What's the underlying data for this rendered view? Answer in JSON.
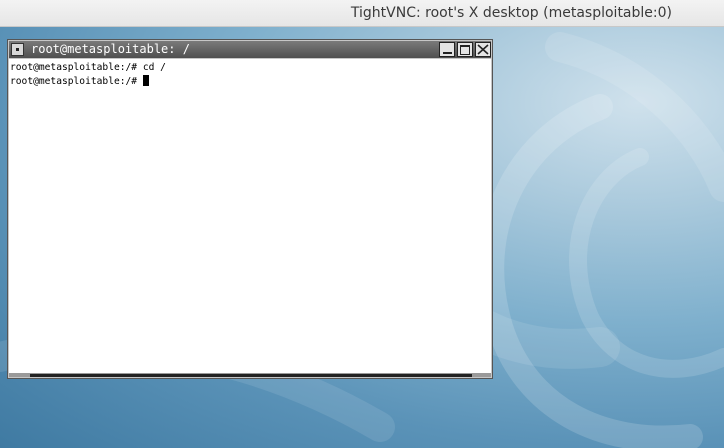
{
  "vnc": {
    "title": "TightVNC: root's X desktop (metasploitable:0)"
  },
  "xterm": {
    "title": "root@metasploitable: /",
    "lines": [
      "root@metasploitable:/# cd /",
      "root@metasploitable:/# "
    ]
  },
  "colors": {
    "desktop_base": "#5b93b8",
    "titlebar_bg": "#e6e6e6",
    "xterm_titlebar": "#4f4f4f",
    "terminal_bg": "#ffffff"
  },
  "icons": [
    "window-menu-icon",
    "minimize-icon",
    "maximize-icon",
    "close-icon",
    "debian-swirl-wallpaper"
  ]
}
